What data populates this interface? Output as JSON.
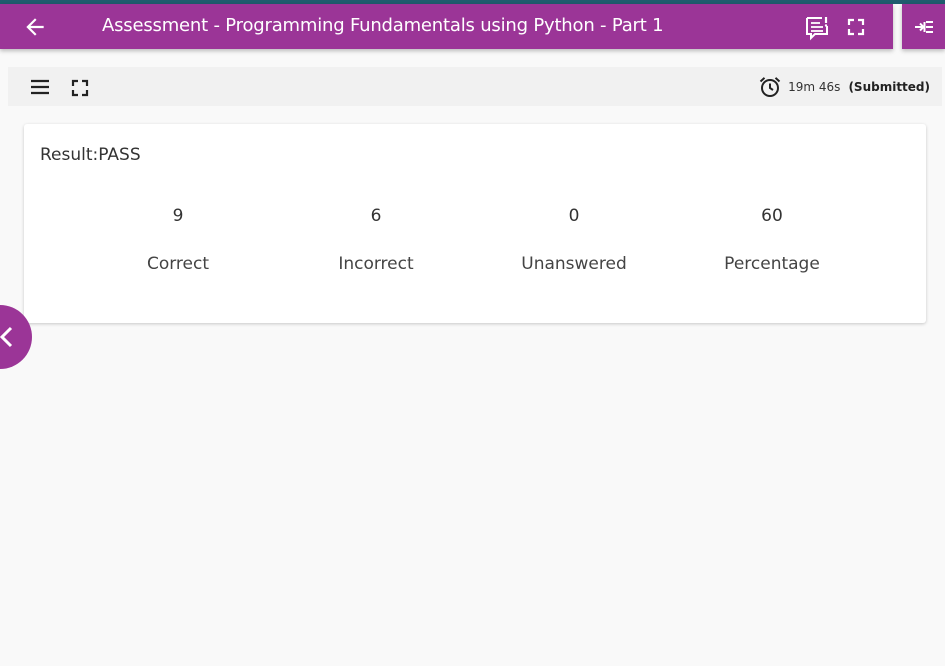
{
  "colors": {
    "brand": "#9b3597",
    "top_strip": "#1f5c6e",
    "background": "#f9f9f9",
    "toolbar_bg": "#f1f1f1",
    "card_bg": "#ffffff"
  },
  "app_bar": {
    "back_icon": "arrow-left-icon",
    "title": "Assessment - Programming Fundamentals using Python - Part 1",
    "feedback_icon": "feedback-icon",
    "fullscreen_icon": "fullscreen-icon",
    "side_toggle_icon": "collapse-right-icon"
  },
  "toolbar": {
    "menu_icon": "hamburger-menu-icon",
    "expand_icon": "expand-icon",
    "timer": {
      "icon": "alarm-clock-icon",
      "time": "19m 46s",
      "status": "(Submitted)"
    }
  },
  "result": {
    "label": "Result:PASS",
    "stats": [
      {
        "value": "9",
        "label": "Correct"
      },
      {
        "value": "6",
        "label": "Incorrect"
      },
      {
        "value": "0",
        "label": "Unanswered"
      },
      {
        "value": "60",
        "label": "Percentage"
      }
    ]
  },
  "left_drawer_button": {
    "icon": "chevron-left-icon"
  }
}
